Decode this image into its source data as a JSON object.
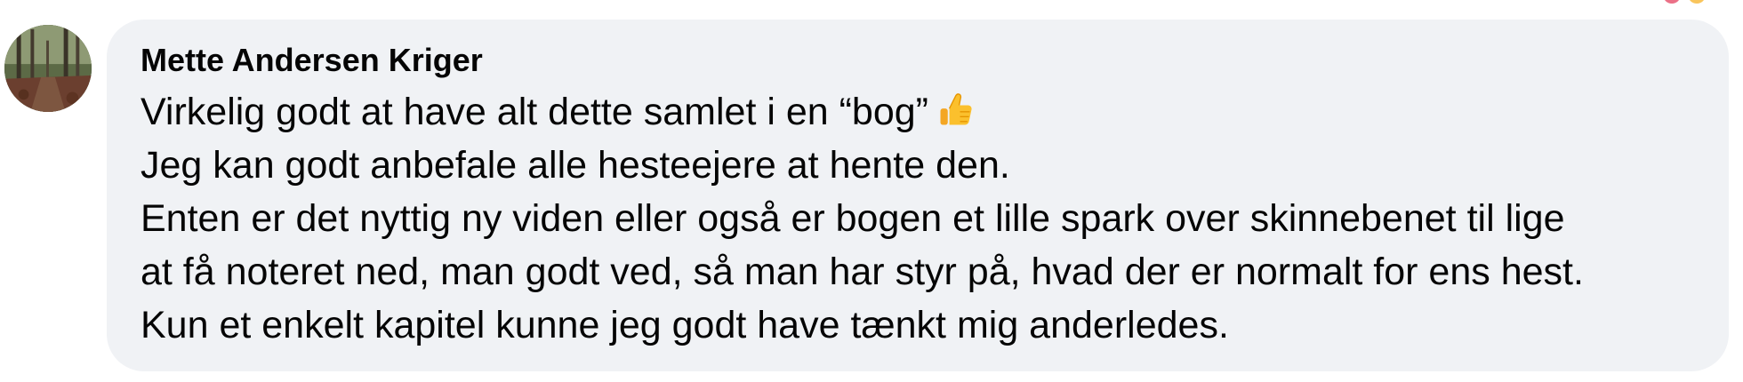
{
  "comment": {
    "author": "Mette Andersen Kriger",
    "lines": [
      "Virkelig godt at have alt dette samlet i en “bog”",
      "Jeg kan godt anbefale alle hesteejere at hente den.",
      "Enten er det nyttig ny viden eller også er bogen et lille spark over skinnebenet til lige",
      "at få noteret ned, man godt ved, så man har styr på, hvad der er normalt for ens hest.",
      "Kun et enkelt kapitel kunne jeg godt have tænkt mig anderledes."
    ],
    "inline_emoji": "thumbs-up-icon"
  },
  "avatar": {
    "icon": "profile-photo-forest-path"
  },
  "colors": {
    "bubble_background": "#f0f2f5",
    "text": "#050505",
    "page_background": "#ffffff"
  }
}
